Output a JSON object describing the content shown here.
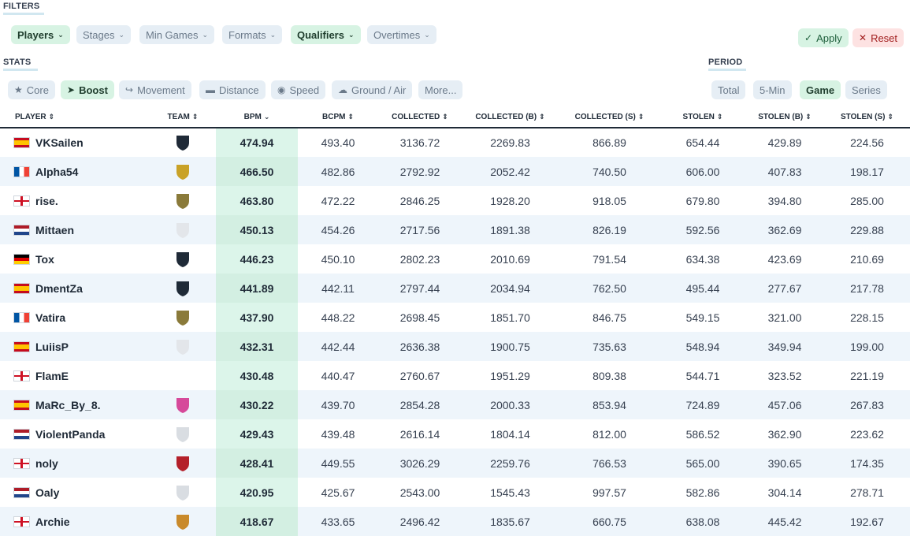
{
  "filters": {
    "section_label": "FILTERS",
    "chips": [
      {
        "label": "Players",
        "active": true
      },
      {
        "label": "Stages",
        "active": false
      },
      {
        "label": "Min Games",
        "active": false
      },
      {
        "label": "Formats",
        "active": false
      },
      {
        "label": "Qualifiers",
        "active": true
      },
      {
        "label": "Overtimes",
        "active": false
      }
    ],
    "apply_label": "Apply",
    "reset_label": "Reset"
  },
  "stats": {
    "section_label": "STATS",
    "tabs": [
      {
        "label": "Core",
        "icon": "star-icon",
        "active": false
      },
      {
        "label": "Boost",
        "icon": "rocket-icon",
        "active": true
      },
      {
        "label": "Movement",
        "icon": "running-icon",
        "active": false
      },
      {
        "label": "Distance",
        "icon": "ruler-icon",
        "active": false
      },
      {
        "label": "Speed",
        "icon": "gamepad-icon",
        "active": false
      },
      {
        "label": "Ground / Air",
        "icon": "cloud-icon",
        "active": false
      },
      {
        "label": "More...",
        "icon": "",
        "active": false
      }
    ]
  },
  "period": {
    "section_label": "PERIOD",
    "tabs": [
      {
        "label": "Total",
        "active": false
      },
      {
        "label": "5-Min",
        "active": false
      },
      {
        "label": "Game",
        "active": true
      },
      {
        "label": "Series",
        "active": false
      }
    ]
  },
  "table": {
    "columns": [
      "PLAYER",
      "TEAM",
      "BPM",
      "BCPM",
      "COLLECTED",
      "COLLECTED (B)",
      "COLLECTED (S)",
      "STOLEN",
      "STOLEN (B)",
      "STOLEN (S)"
    ],
    "rows": [
      {
        "player": "VKSailen",
        "flag": "es",
        "team_logo": "team-a-logo",
        "bpm": "474.94",
        "bcpm": "493.40",
        "collected": "3136.72",
        "collected_b": "2269.83",
        "collected_s": "866.89",
        "stolen": "654.44",
        "stolen_b": "429.89",
        "stolen_s": "224.56"
      },
      {
        "player": "Alpha54",
        "flag": "fr",
        "team_logo": "team-b-logo",
        "bpm": "466.50",
        "bcpm": "482.86",
        "collected": "2792.92",
        "collected_b": "2052.42",
        "collected_s": "740.50",
        "stolen": "606.00",
        "stolen_b": "407.83",
        "stolen_s": "198.17"
      },
      {
        "player": "rise.",
        "flag": "en",
        "team_logo": "team-c-logo",
        "bpm": "463.80",
        "bcpm": "472.22",
        "collected": "2846.25",
        "collected_b": "1928.20",
        "collected_s": "918.05",
        "stolen": "679.80",
        "stolen_b": "394.80",
        "stolen_s": "285.00"
      },
      {
        "player": "Mittaen",
        "flag": "nl",
        "team_logo": "team-d-logo",
        "bpm": "450.13",
        "bcpm": "454.26",
        "collected": "2717.56",
        "collected_b": "1891.38",
        "collected_s": "826.19",
        "stolen": "592.56",
        "stolen_b": "362.69",
        "stolen_s": "229.88"
      },
      {
        "player": "Tox",
        "flag": "de",
        "team_logo": "team-e-logo",
        "bpm": "446.23",
        "bcpm": "450.10",
        "collected": "2802.23",
        "collected_b": "2010.69",
        "collected_s": "791.54",
        "stolen": "634.38",
        "stolen_b": "423.69",
        "stolen_s": "210.69"
      },
      {
        "player": "DmentZa",
        "flag": "es",
        "team_logo": "team-a-logo",
        "bpm": "441.89",
        "bcpm": "442.11",
        "collected": "2797.44",
        "collected_b": "2034.94",
        "collected_s": "762.50",
        "stolen": "495.44",
        "stolen_b": "277.67",
        "stolen_s": "217.78"
      },
      {
        "player": "Vatira",
        "flag": "fr",
        "team_logo": "team-c-logo",
        "bpm": "437.90",
        "bcpm": "448.22",
        "collected": "2698.45",
        "collected_b": "1851.70",
        "collected_s": "846.75",
        "stolen": "549.15",
        "stolen_b": "321.00",
        "stolen_s": "228.15"
      },
      {
        "player": "LuiisP",
        "flag": "es",
        "team_logo": "team-d-logo",
        "bpm": "432.31",
        "bcpm": "442.44",
        "collected": "2636.38",
        "collected_b": "1900.75",
        "collected_s": "735.63",
        "stolen": "548.94",
        "stolen_b": "349.94",
        "stolen_s": "199.00"
      },
      {
        "player": "FlamE",
        "flag": "en",
        "team_logo": "",
        "bpm": "430.48",
        "bcpm": "440.47",
        "collected": "2760.67",
        "collected_b": "1951.29",
        "collected_s": "809.38",
        "stolen": "544.71",
        "stolen_b": "323.52",
        "stolen_s": "221.19"
      },
      {
        "player": "MaRc_By_8.",
        "flag": "es",
        "team_logo": "team-f-logo",
        "bpm": "430.22",
        "bcpm": "439.70",
        "collected": "2854.28",
        "collected_b": "2000.33",
        "collected_s": "853.94",
        "stolen": "724.89",
        "stolen_b": "457.06",
        "stolen_s": "267.83"
      },
      {
        "player": "ViolentPanda",
        "flag": "nl",
        "team_logo": "team-g-logo",
        "bpm": "429.43",
        "bcpm": "439.48",
        "collected": "2616.14",
        "collected_b": "1804.14",
        "collected_s": "812.00",
        "stolen": "586.52",
        "stolen_b": "362.90",
        "stolen_s": "223.62"
      },
      {
        "player": "noly",
        "flag": "en",
        "team_logo": "team-h-logo",
        "bpm": "428.41",
        "bcpm": "449.55",
        "collected": "3026.29",
        "collected_b": "2259.76",
        "collected_s": "766.53",
        "stolen": "565.00",
        "stolen_b": "390.65",
        "stolen_s": "174.35"
      },
      {
        "player": "Oaly",
        "flag": "nl",
        "team_logo": "team-g-logo",
        "bpm": "420.95",
        "bcpm": "425.67",
        "collected": "2543.00",
        "collected_b": "1545.43",
        "collected_s": "997.57",
        "stolen": "582.86",
        "stolen_b": "304.14",
        "stolen_s": "278.71"
      },
      {
        "player": "Archie",
        "flag": "en",
        "team_logo": "team-i-logo",
        "bpm": "418.67",
        "bcpm": "433.65",
        "collected": "2496.42",
        "collected_b": "1835.67",
        "collected_s": "660.75",
        "stolen": "638.08",
        "stolen_b": "445.42",
        "stolen_s": "192.67"
      }
    ]
  },
  "colors": {
    "active_chip": "#d7f3e3",
    "inactive_chip": "#e6eef5",
    "bpm_highlight": "#dcf5ea",
    "row_stripe": "#eef5fb",
    "reset": "#fde2e2"
  }
}
